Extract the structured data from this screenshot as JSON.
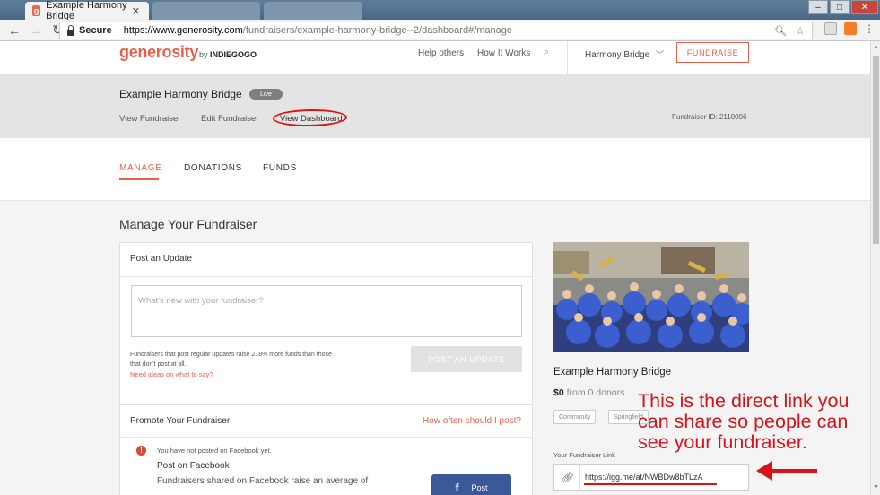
{
  "browser": {
    "tabs": [
      {
        "title": "Example Harmony Bridge"
      },
      {
        "title": ""
      },
      {
        "title": ""
      }
    ],
    "favicon_letter": "g",
    "secure_label": "Secure",
    "url_host": "https://www.generosity.com",
    "url_path": "/fundraisers/example-harmony-bridge--2/dashboard#/manage",
    "window_buttons": {
      "minimize": "–",
      "maximize": "□",
      "close": "✕"
    }
  },
  "header": {
    "logo": "generosity",
    "by_prefix": "by",
    "by_brand": "INDIEGOGO",
    "help_others": "Help others",
    "how_it_works": "How It Works",
    "user_name": "Harmony Bridge",
    "fundraise_button": "FUNDRAISE"
  },
  "subheader": {
    "title": "Example Harmony Bridge",
    "status_badge": "Live",
    "links": [
      "View Fundraiser",
      "Edit Fundraiser",
      "View Dashboard"
    ],
    "fundraiser_id": "Fundraiser ID: 2110096"
  },
  "tabs": [
    "MANAGE",
    "DONATIONS",
    "FUNDS"
  ],
  "main": {
    "page_title": "Manage Your Fundraiser",
    "post_update": {
      "heading": "Post an Update",
      "placeholder": "What's new with your fundraiser?",
      "info_line1": "Fundraisers that post regular updates raise 218% more funds than those",
      "info_line2": "that don't post at all.",
      "ideas_link": "Need ideas on what to say?",
      "button": "POST AN UPDATE"
    },
    "promote": {
      "heading": "Promote Your Fundraiser",
      "link": "How often should I post?",
      "warning": "You have not posted on Facebook yet.",
      "fb_title": "Post on Facebook",
      "fb_desc": "Fundraisers shared on Facebook raise an average of",
      "fb_button": "Post"
    }
  },
  "sidebar": {
    "title": "Example Harmony Bridge",
    "amount": "$0",
    "donors": "from 0 donors",
    "tags": [
      "Community",
      "Springfield"
    ],
    "link_label": "Your Fundraiser Link",
    "link_url": "https://igg.me/at/NWBDw8bTLzA"
  },
  "annotation": "This is the direct link you can share so people can see your fundraiser."
}
